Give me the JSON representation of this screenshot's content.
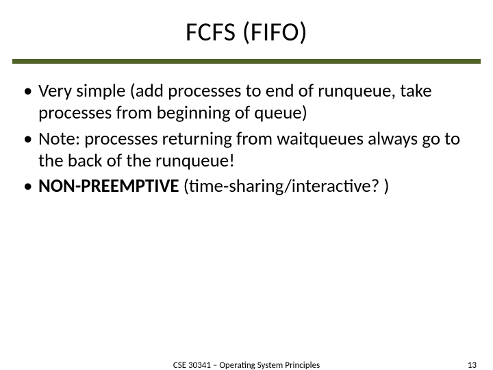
{
  "title": "FCFS (FIFO)",
  "bullets": {
    "b1": "Very simple (add processes to end of runqueue, take processes from beginning of queue)",
    "b2": "Note: processes returning from waitqueues always go to the back of the runqueue!",
    "b3_strong": "NON-PREEMPTIVE",
    "b3_rest": " (time-sharing/interactive? )"
  },
  "footer": {
    "course": "CSE 30341 – Operating System Principles",
    "page": "13"
  }
}
